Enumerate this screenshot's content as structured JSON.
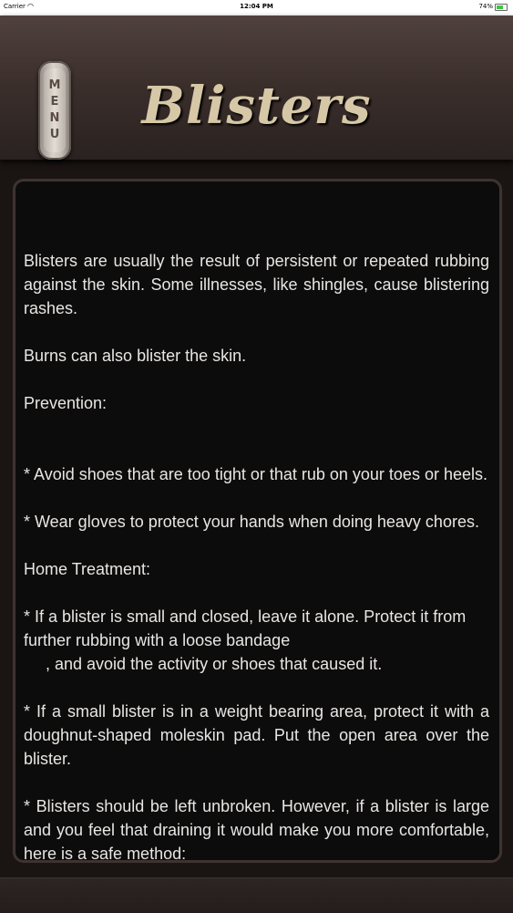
{
  "status_bar": {
    "carrier": "Carrier",
    "wifi_icon": "wifi-icon",
    "time": "12:04 PM",
    "battery_percent": "74%",
    "battery_level": 0.74
  },
  "header": {
    "menu_letters": [
      "M",
      "E",
      "N",
      "U"
    ],
    "title": "Blisters"
  },
  "content": {
    "paragraphs": [
      "Blisters are usually the result of persistent or repeated rubbing against the skin. Some illnesses, like shingles, cause blistering rashes.",
      "Burns can also blister the skin.",
      "Prevention:",
      " * Avoid shoes that are too tight or that rub on your toes or heels.",
      " * Wear gloves to protect your hands when doing heavy chores.",
      "Home Treatment:",
      " * If a blister is small and closed, leave it alone. Protect it from further rubbing with a loose bandage",
      ", and avoid the activity or shoes that caused it.",
      " * If a small blister is in a weight bearing area, protect it with a doughnut-shaped moleskin pad. Put the open area over the blister.",
      " * Blisters should be left unbroken. However, if a blister is large and you feel that draining it would make you more comfortable, here is a safe method:"
    ]
  },
  "colors": {
    "background": "#1a1412",
    "title": "#d6c8a6",
    "text": "#e8e6e3",
    "battery": "#3fc43f"
  }
}
